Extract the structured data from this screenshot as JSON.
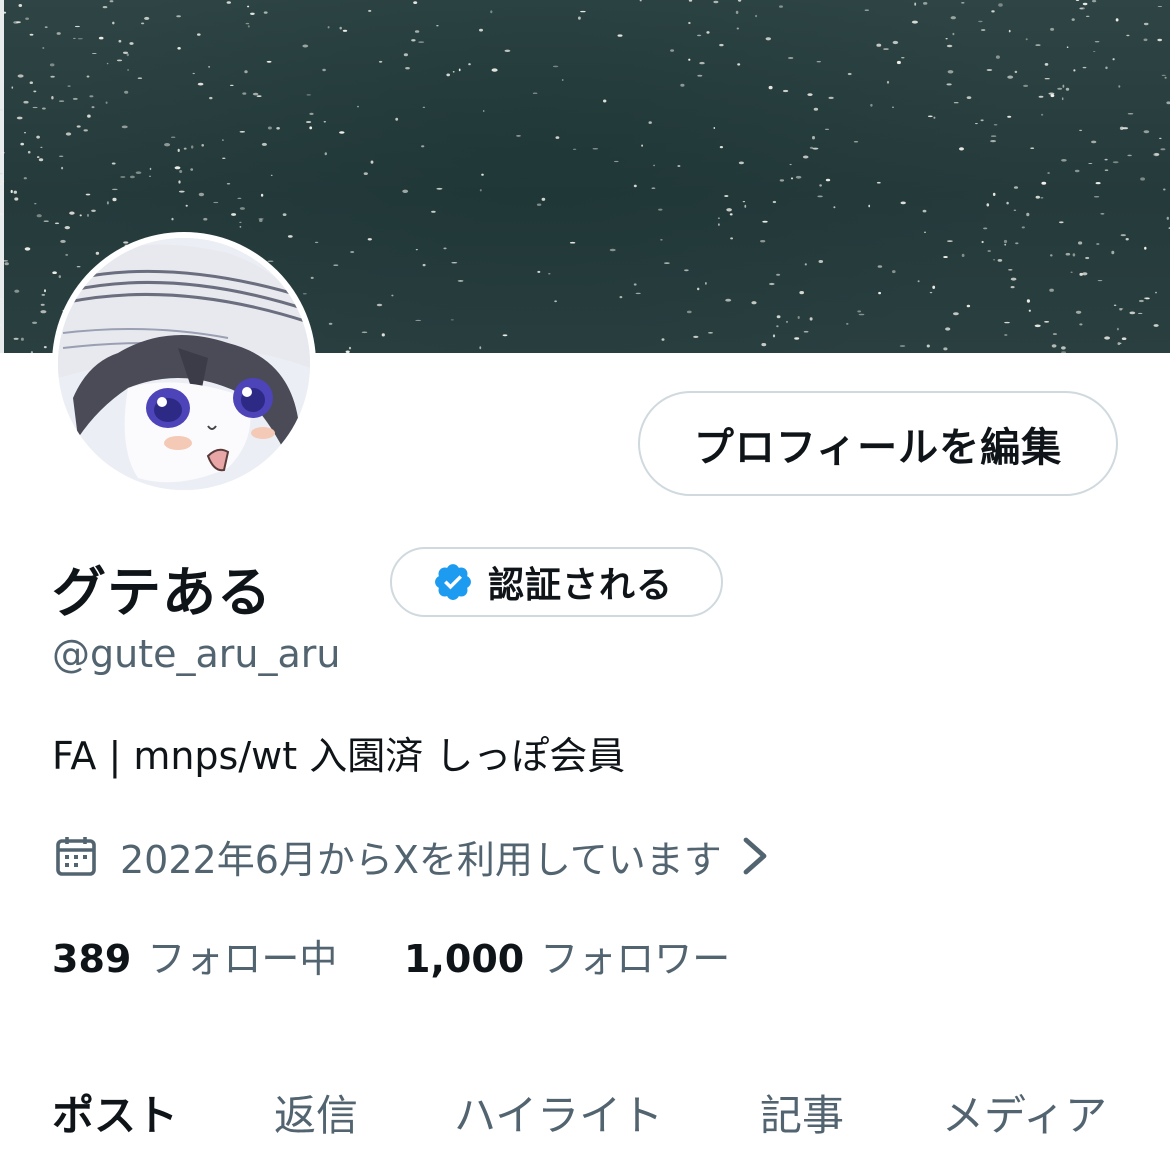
{
  "profile": {
    "display_name": "グテある",
    "handle": "@gute_aru_aru",
    "bio": "FA | mnps/wt 入園済 しっぽ会員",
    "joined": "2022年6月からXを利用しています",
    "edit_profile_label": "プロフィールを編集",
    "verify_label": "認証される"
  },
  "stats": {
    "following_count": "389",
    "following_label": "フォロー中",
    "followers_count": "1,000",
    "followers_label": "フォロワー"
  },
  "tabs": [
    {
      "label": "ポスト",
      "active": true
    },
    {
      "label": "返信",
      "active": false
    },
    {
      "label": "ハイライト",
      "active": false
    },
    {
      "label": "記事",
      "active": false
    },
    {
      "label": "メディア",
      "active": false
    }
  ],
  "colors": {
    "text_primary": "#0f1419",
    "text_secondary": "#536471",
    "verified_blue": "#1d9bf0",
    "border": "#cfd9de",
    "banner": "#2b4142"
  },
  "icons": {
    "verify": "verified-badge-icon",
    "calendar": "calendar-icon",
    "chevron": "chevron-right-icon"
  }
}
